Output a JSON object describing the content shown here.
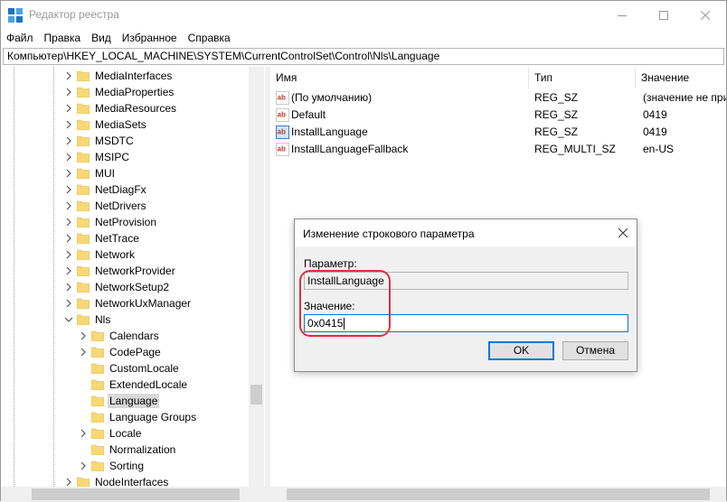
{
  "window": {
    "title": "Редактор реестра"
  },
  "menu": [
    "Файл",
    "Правка",
    "Вид",
    "Избранное",
    "Справка"
  ],
  "address": "Компьютер\\HKEY_LOCAL_MACHINE\\SYSTEM\\CurrentControlSet\\Control\\Nls\\Language",
  "tree": [
    {
      "label": "MediaInterfaces",
      "level": 1,
      "expand": "collapsed"
    },
    {
      "label": "MediaProperties",
      "level": 1,
      "expand": "collapsed"
    },
    {
      "label": "MediaResources",
      "level": 1,
      "expand": "collapsed"
    },
    {
      "label": "MediaSets",
      "level": 1,
      "expand": "collapsed"
    },
    {
      "label": "MSDTC",
      "level": 1,
      "expand": "collapsed"
    },
    {
      "label": "MSIPC",
      "level": 1,
      "expand": "collapsed"
    },
    {
      "label": "MUI",
      "level": 1,
      "expand": "collapsed"
    },
    {
      "label": "NetDiagFx",
      "level": 1,
      "expand": "collapsed"
    },
    {
      "label": "NetDrivers",
      "level": 1,
      "expand": "collapsed"
    },
    {
      "label": "NetProvision",
      "level": 1,
      "expand": "collapsed"
    },
    {
      "label": "NetTrace",
      "level": 1,
      "expand": "collapsed"
    },
    {
      "label": "Network",
      "level": 1,
      "expand": "collapsed"
    },
    {
      "label": "NetworkProvider",
      "level": 1,
      "expand": "collapsed"
    },
    {
      "label": "NetworkSetup2",
      "level": 1,
      "expand": "collapsed"
    },
    {
      "label": "NetworkUxManager",
      "level": 1,
      "expand": "collapsed"
    },
    {
      "label": "Nls",
      "level": 1,
      "expand": "expanded"
    },
    {
      "label": "Calendars",
      "level": 2,
      "expand": "collapsed"
    },
    {
      "label": "CodePage",
      "level": 2,
      "expand": "collapsed"
    },
    {
      "label": "CustomLocale",
      "level": 2,
      "expand": "none"
    },
    {
      "label": "ExtendedLocale",
      "level": 2,
      "expand": "none"
    },
    {
      "label": "Language",
      "level": 2,
      "expand": "none",
      "selected": true
    },
    {
      "label": "Language Groups",
      "level": 2,
      "expand": "none"
    },
    {
      "label": "Locale",
      "level": 2,
      "expand": "collapsed"
    },
    {
      "label": "Normalization",
      "level": 2,
      "expand": "none"
    },
    {
      "label": "Sorting",
      "level": 2,
      "expand": "collapsed"
    },
    {
      "label": "NodeInterfaces",
      "level": 1,
      "expand": "collapsed"
    }
  ],
  "list": {
    "columns": [
      "Имя",
      "Тип",
      "Значение"
    ],
    "rows": [
      {
        "name": "(По умолчанию)",
        "type": "REG_SZ",
        "value": "(значение не присвоено)",
        "icon": "string-value-icon"
      },
      {
        "name": "Default",
        "type": "REG_SZ",
        "value": "0419",
        "icon": "string-value-icon"
      },
      {
        "name": "InstallLanguage",
        "type": "REG_SZ",
        "value": "0419",
        "icon": "selected-string-value-icon"
      },
      {
        "name": "InstallLanguageFallback",
        "type": "REG_MULTI_SZ",
        "value": "en-US",
        "icon": "string-value-icon"
      }
    ]
  },
  "dialog": {
    "title": "Изменение строкового параметра",
    "param_label": "Параметр:",
    "param_value": "InstallLanguage",
    "value_label": "Значение:",
    "value": "0x0415",
    "ok": "OK",
    "cancel": "Отмена"
  },
  "colors": {
    "accent": "#0078d7",
    "annotation": "#d8323c",
    "folder": "#f8d775"
  }
}
